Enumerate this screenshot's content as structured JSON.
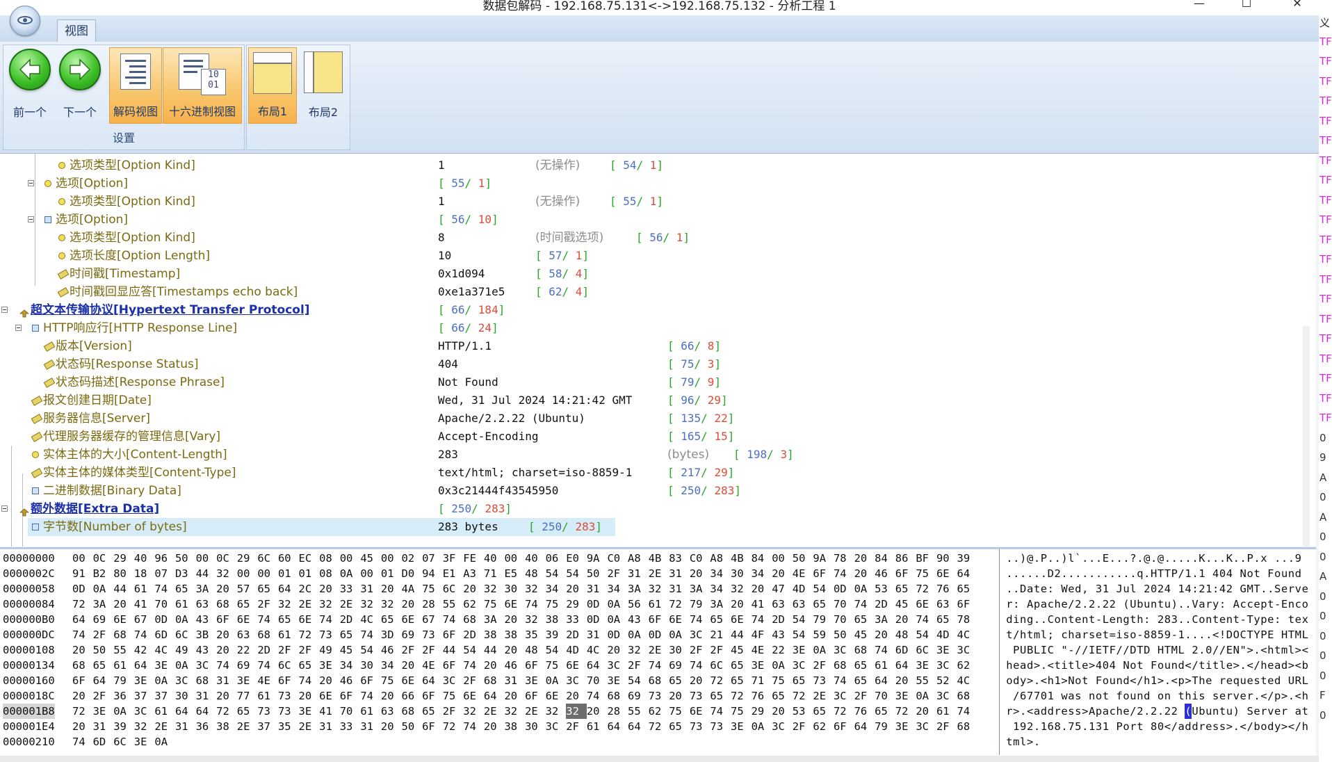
{
  "window": {
    "title": "数据包解码 - 192.168.75.131<->192.168.75.132 - 分析工程 1",
    "minimize": "—",
    "maximize": "☐",
    "close": "✕"
  },
  "ribbon": {
    "tab_label": "视图",
    "group_label": "设置",
    "buttons": {
      "prev": "前一个",
      "next": "下一个",
      "decode_view": "解码视图",
      "hex_view": "十六进制视图",
      "layout1": "布局1",
      "layout2": "布局2"
    },
    "hex_icon_text": "10\n01"
  },
  "tree": {
    "rows": [
      {
        "label": "选项类型[Option Kind]",
        "value": "1",
        "note": "(无操作)",
        "offset": "54",
        "length": "1"
      },
      {
        "label": "选项[Option]",
        "value": "",
        "note": "",
        "offset": "55",
        "length": "1"
      },
      {
        "label": "选项类型[Option Kind]",
        "value": "1",
        "note": "(无操作)",
        "offset": "55",
        "length": "1"
      },
      {
        "label": "选项[Option]",
        "value": "",
        "note": "",
        "offset": "56",
        "length": "10"
      },
      {
        "label": "选项类型[Option Kind]",
        "value": "8",
        "note": "(时间戳选项)",
        "offset": "56",
        "length": "1"
      },
      {
        "label": "选项长度[Option Length]",
        "value": "10",
        "note": "",
        "offset": "57",
        "length": "1"
      },
      {
        "label": "时间戳[Timestamp]",
        "value": "0x1d094",
        "note": "",
        "offset": "58",
        "length": "4"
      },
      {
        "label": "时间戳回显应答[Timestamps echo back]",
        "value": "0xe1a371e5",
        "note": "",
        "offset": "62",
        "length": "4"
      },
      {
        "label": "超文本传输协议[Hypertext Transfer Protocol]",
        "value": "",
        "note": "",
        "offset": "66",
        "length": "184"
      },
      {
        "label": "HTTP响应行[HTTP Response Line]",
        "value": "",
        "note": "",
        "offset": "66",
        "length": "24"
      },
      {
        "label": "版本[Version]",
        "value": "HTTP/1.1",
        "note": "",
        "offset": "66",
        "length": "8"
      },
      {
        "label": "状态码[Response Status]",
        "value": "404",
        "note": "",
        "offset": "75",
        "length": "3"
      },
      {
        "label": "状态码描述[Response Phrase]",
        "value": "Not Found",
        "note": "",
        "offset": "79",
        "length": "9"
      },
      {
        "label": "报文创建日期[Date]",
        "value": "Wed, 31 Jul 2024 14:21:42 GMT",
        "note": "",
        "offset": "96",
        "length": "29"
      },
      {
        "label": "服务器信息[Server]",
        "value": "Apache/2.2.22 (Ubuntu)",
        "note": "",
        "offset": "135",
        "length": "22"
      },
      {
        "label": "代理服务器缓存的管理信息[Vary]",
        "value": "Accept-Encoding",
        "note": "",
        "offset": "165",
        "length": "15"
      },
      {
        "label": "实体主体的大小[Content-Length]",
        "value": "283",
        "note": "(bytes)",
        "offset": "198",
        "length": "3"
      },
      {
        "label": "实体主体的媒体类型[Content-Type]",
        "value": "text/html; charset=iso-8859-1",
        "note": "",
        "offset": "217",
        "length": "29"
      },
      {
        "label": "二进制数据[Binary Data]",
        "value": "0x3c21444f43545950",
        "note": "",
        "offset": "250",
        "length": "283"
      },
      {
        "label": "额外数据[Extra Data]",
        "value": "",
        "note": "",
        "offset": "250",
        "length": "283"
      },
      {
        "label": "字节数[Number of bytes]",
        "value": "283 bytes",
        "note": "",
        "offset": "250",
        "length": "283"
      }
    ]
  },
  "hex": {
    "rows": [
      {
        "addr": "00000000",
        "bytes": "00 0C 29 40 96 50 00 0C 29 6C 60 EC 08 00 45 00 02 07 3F FE 40 00 40 06 E0 9A C0 A8 4B 83 C0 A8 4B 84 00 50 9A 78 20 84 86 BF 90 39",
        "ascii": "..)@.P..)l`...E...?.@.@.....K...K..P.x ...9"
      },
      {
        "addr": "0000002C",
        "bytes": "91 B2 80 18 07 D3 44 32 00 00 01 01 08 0A 00 01 D0 94 E1 A3 71 E5 48 54 54 50 2F 31 2E 31 20 34 30 34 20 4E 6F 74 20 46 6F 75 6E 64",
        "ascii": "......D2...........q.HTTP/1.1 404 Not Found"
      },
      {
        "addr": "00000058",
        "bytes": "0D 0A 44 61 74 65 3A 20 57 65 64 2C 20 33 31 20 4A 75 6C 20 32 30 32 34 20 31 34 3A 32 31 3A 34 32 20 47 4D 54 0D 0A 53 65 72 76 65",
        "ascii": "..Date: Wed, 31 Jul 2024 14:21:42 GMT..Serve"
      },
      {
        "addr": "00000084",
        "bytes": "72 3A 20 41 70 61 63 68 65 2F 32 2E 32 2E 32 32 20 28 55 62 75 6E 74 75 29 0D 0A 56 61 72 79 3A 20 41 63 63 65 70 74 2D 45 6E 63 6F",
        "ascii": "r: Apache/2.2.22 (Ubuntu)..Vary: Accept-Enco"
      },
      {
        "addr": "000000B0",
        "bytes": "64 69 6E 67 0D 0A 43 6F 6E 74 65 6E 74 2D 4C 65 6E 67 74 68 3A 20 32 38 33 0D 0A 43 6F 6E 74 65 6E 74 2D 54 79 70 65 3A 20 74 65 78",
        "ascii": "ding..Content-Length: 283..Content-Type: tex"
      },
      {
        "addr": "000000DC",
        "bytes": "74 2F 68 74 6D 6C 3B 20 63 68 61 72 73 65 74 3D 69 73 6F 2D 38 38 35 39 2D 31 0D 0A 0D 0A 3C 21 44 4F 43 54 59 50 45 20 48 54 4D 4C",
        "ascii": "t/html; charset=iso-8859-1....<!DOCTYPE HTML"
      },
      {
        "addr": "00000108",
        "bytes": "20 50 55 42 4C 49 43 20 22 2D 2F 2F 49 45 54 46 2F 2F 44 54 44 20 48 54 4D 4C 20 32 2E 30 2F 2F 45 4E 22 3E 0A 3C 68 74 6D 6C 3E 3C",
        "ascii": " PUBLIC \"-//IETF//DTD HTML 2.0//EN\">.<html><"
      },
      {
        "addr": "00000134",
        "bytes": "68 65 61 64 3E 0A 3C 74 69 74 6C 65 3E 34 30 34 20 4E 6F 74 20 46 6F 75 6E 64 3C 2F 74 69 74 6C 65 3E 0A 3C 2F 68 65 61 64 3E 3C 62",
        "ascii": "head>.<title>404 Not Found</title>.</head><b"
      },
      {
        "addr": "00000160",
        "bytes": "6F 64 79 3E 0A 3C 68 31 3E 4E 6F 74 20 46 6F 75 6E 64 3C 2F 68 31 3E 0A 3C 70 3E 54 68 65 20 72 65 71 75 65 73 74 65 64 20 55 52 4C",
        "ascii": "ody>.<h1>Not Found</h1>.<p>The requested URL"
      },
      {
        "addr": "0000018C",
        "bytes": "20 2F 36 37 37 30 31 20 77 61 73 20 6E 6F 74 20 66 6F 75 6E 64 20 6F 6E 20 74 68 69 73 20 73 65 72 76 65 72 2E 3C 2F 70 3E 0A 3C 68",
        "ascii": " /67701 was not found on this server.</p>.<h"
      },
      {
        "addr": "000001B8",
        "bytes": "72 3E 0A 3C 61 64 64 72 65 73 73 3E 41 70 61 63 68 65 2F 32 2E 32 2E 32 32 20 28 55 62 75 6E 74 75 29 20 53 65 72 76 65 72 20 61 74",
        "ascii": "r>.<address>Apache/2.2.22 (Ubuntu) Server at"
      },
      {
        "addr": "000001E4",
        "bytes": "20 31 39 32 2E 31 36 38 2E 37 35 2E 31 33 31 20 50 6F 72 74 20 38 30 3C 2F 61 64 64 72 65 73 73 3E 0A 3C 2F 62 6F 64 79 3E 3C 2F 68",
        "ascii": " 192.168.75.131 Port 80</address>.</body></h"
      },
      {
        "addr": "00000210",
        "bytes": "74 6D 6C 3E 0A",
        "ascii": "tml>."
      }
    ],
    "selected_row": 10,
    "selected_byte": 24
  },
  "edge_fragments": [
    "义",
    "TF",
    "TF",
    "TF",
    "TF",
    "TF",
    "TF",
    "TF",
    "TF",
    "TF",
    "TF",
    "TF",
    "TF",
    "TF",
    "TF",
    "TF",
    "TF",
    "TF",
    "TF",
    "TF",
    "TF",
    "0",
    "9",
    "A",
    "0",
    "A",
    "0",
    "0",
    "A",
    "0",
    "0",
    "0",
    "0",
    "0",
    "F",
    "0"
  ]
}
